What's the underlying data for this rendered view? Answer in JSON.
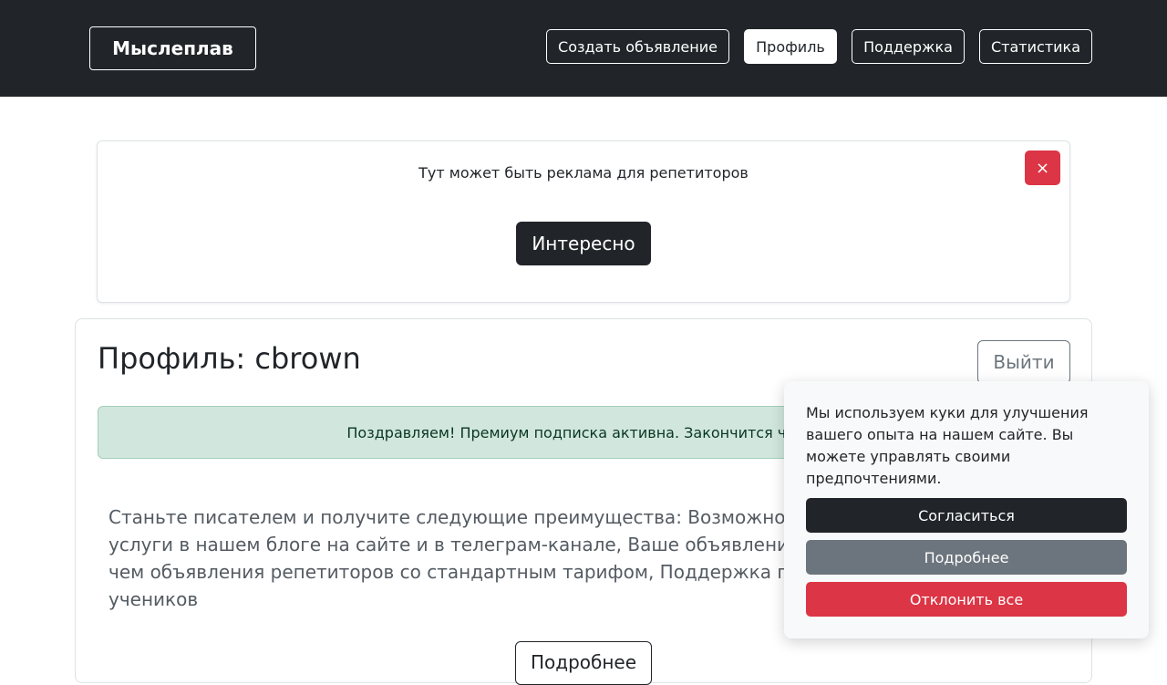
{
  "navbar": {
    "brand": "Мыслеплав",
    "items": [
      {
        "label": "Создать объявление"
      },
      {
        "label": "Профиль",
        "active": true
      },
      {
        "label": "Поддержка"
      },
      {
        "label": "Статистика"
      }
    ]
  },
  "ad": {
    "text": "Тут может быть реклама для репетиторов",
    "close_label": "×",
    "button_label": "Интересно"
  },
  "profile": {
    "title": "Профиль: cbrown",
    "logout_label": "Выйти",
    "alert_text": "Поздравляем! Премиум подписка активна. Закончится через",
    "benefits_text": "Станьте писателем и получите следующие преимущества: Возможность рекламировать свои услуги в нашем блоге на сайте и в телеграм-канале, Ваше объявление будет располагаться выше, чем объявления репетиторов со стандартным тарифом, Поддержка платформы, репетиторов и учеников",
    "bottom_button_label": "Подробнее"
  },
  "cookie": {
    "text": "Мы используем куки для улучшения вашего опыта на нашем сайте. Вы можете управлять своими предпочтениями.",
    "accept_label": "Согласиться",
    "more_label": "Подробнее",
    "reject_label": "Отклонить все"
  },
  "colors": {
    "navbar_bg": "#212529",
    "danger": "#dc3545",
    "secondary": "#6c757d",
    "success_bg": "#d1e7dd"
  }
}
